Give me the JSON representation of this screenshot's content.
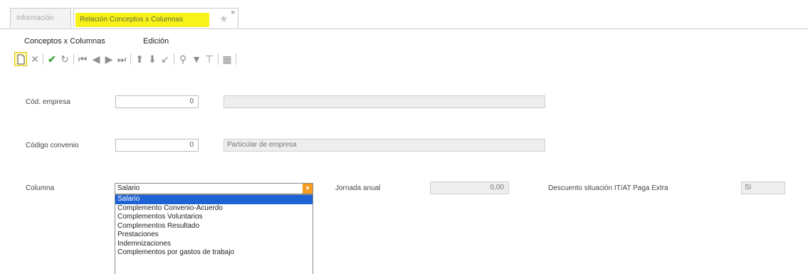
{
  "tabs": [
    {
      "label": "Información"
    },
    {
      "label": "Relación Conceptos x Columnas"
    }
  ],
  "menu": {
    "item1": "Conceptos x Columnas",
    "item2": "Edición"
  },
  "toolbar": {
    "icons": [
      "new-icon",
      "delete-icon",
      "accept-icon",
      "undo-icon",
      "first-icon",
      "previous-icon",
      "next-icon",
      "last-icon",
      "move-up-icon",
      "move-down-icon",
      "sort-icon",
      "search-icon",
      "filter-icon",
      "clear-filter-icon",
      "calendar-icon"
    ]
  },
  "form": {
    "empresa": {
      "label": "Cód. empresa",
      "value": "0",
      "description": ""
    },
    "convenio": {
      "label": "Código convenio",
      "value": "0",
      "description": "Particular de empresa"
    },
    "columna": {
      "label": "Columna",
      "selected": "Salario",
      "options": [
        "Salario",
        "Complemento Convenio-Acuerdo",
        "Complementos Voluntarios",
        "Complementos Resultado",
        "Prestaciones",
        "Indemnizaciones",
        "Complementos por gastos de trabajo"
      ]
    },
    "jornada": {
      "label": "Jornada anual",
      "value": "0,00"
    },
    "descuento": {
      "label": "Descuento situación IT/AT Paga Extra",
      "value": "Sí"
    }
  },
  "colors": {
    "active_tab": "#f6f21a",
    "combo_button": "#f59d1f",
    "selection": "#1e63d6"
  }
}
